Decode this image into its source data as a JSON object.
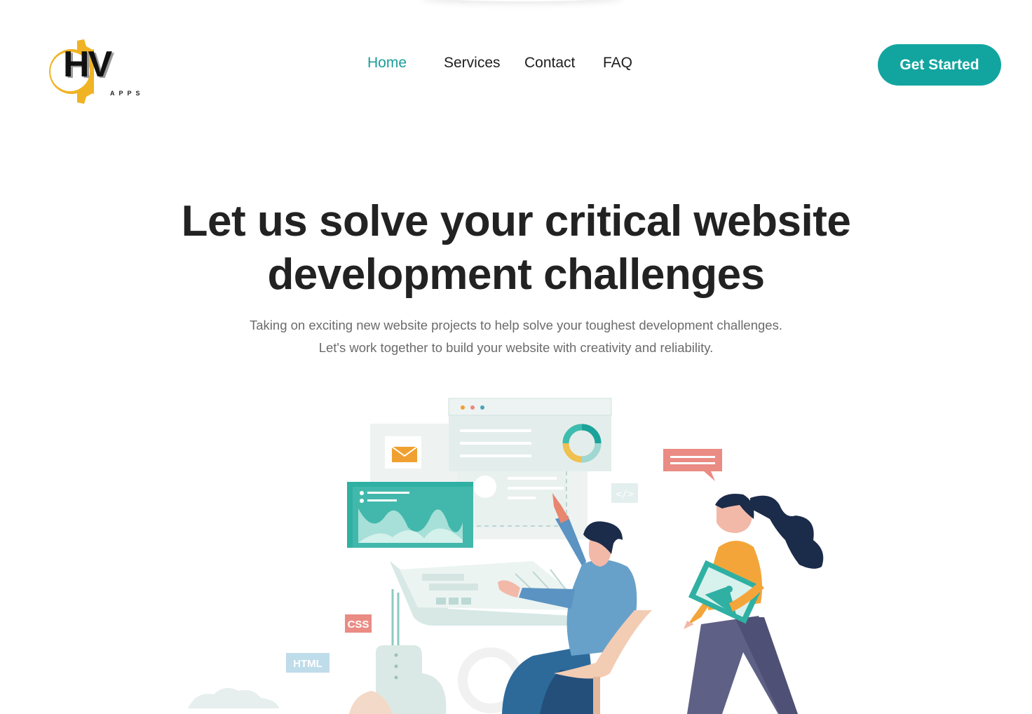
{
  "brand": {
    "logo_text": "HV",
    "logo_sub": "APPS",
    "gear_color": "#f0b323"
  },
  "nav": {
    "items": [
      {
        "label": "Home",
        "active": true
      },
      {
        "label": "Services",
        "active": false
      },
      {
        "label": "Contact",
        "active": false
      },
      {
        "label": "FAQ",
        "active": false
      }
    ]
  },
  "cta": {
    "label": "Get Started",
    "color": "#12a5a0"
  },
  "hero": {
    "title_line1": "Let us solve your critical website",
    "title_line2": "development challenges",
    "subtitle_line1": "Taking on exciting new website projects to help solve your toughest development challenges.",
    "subtitle_line2": "Let's work together to build your website with creativity and reliability."
  },
  "illustration": {
    "tag_css": "CSS",
    "tag_html": "HTML",
    "code_symbol": "</>"
  },
  "colors": {
    "accent": "#12a5a0",
    "text": "#222222",
    "muted": "#6b6b6b"
  }
}
